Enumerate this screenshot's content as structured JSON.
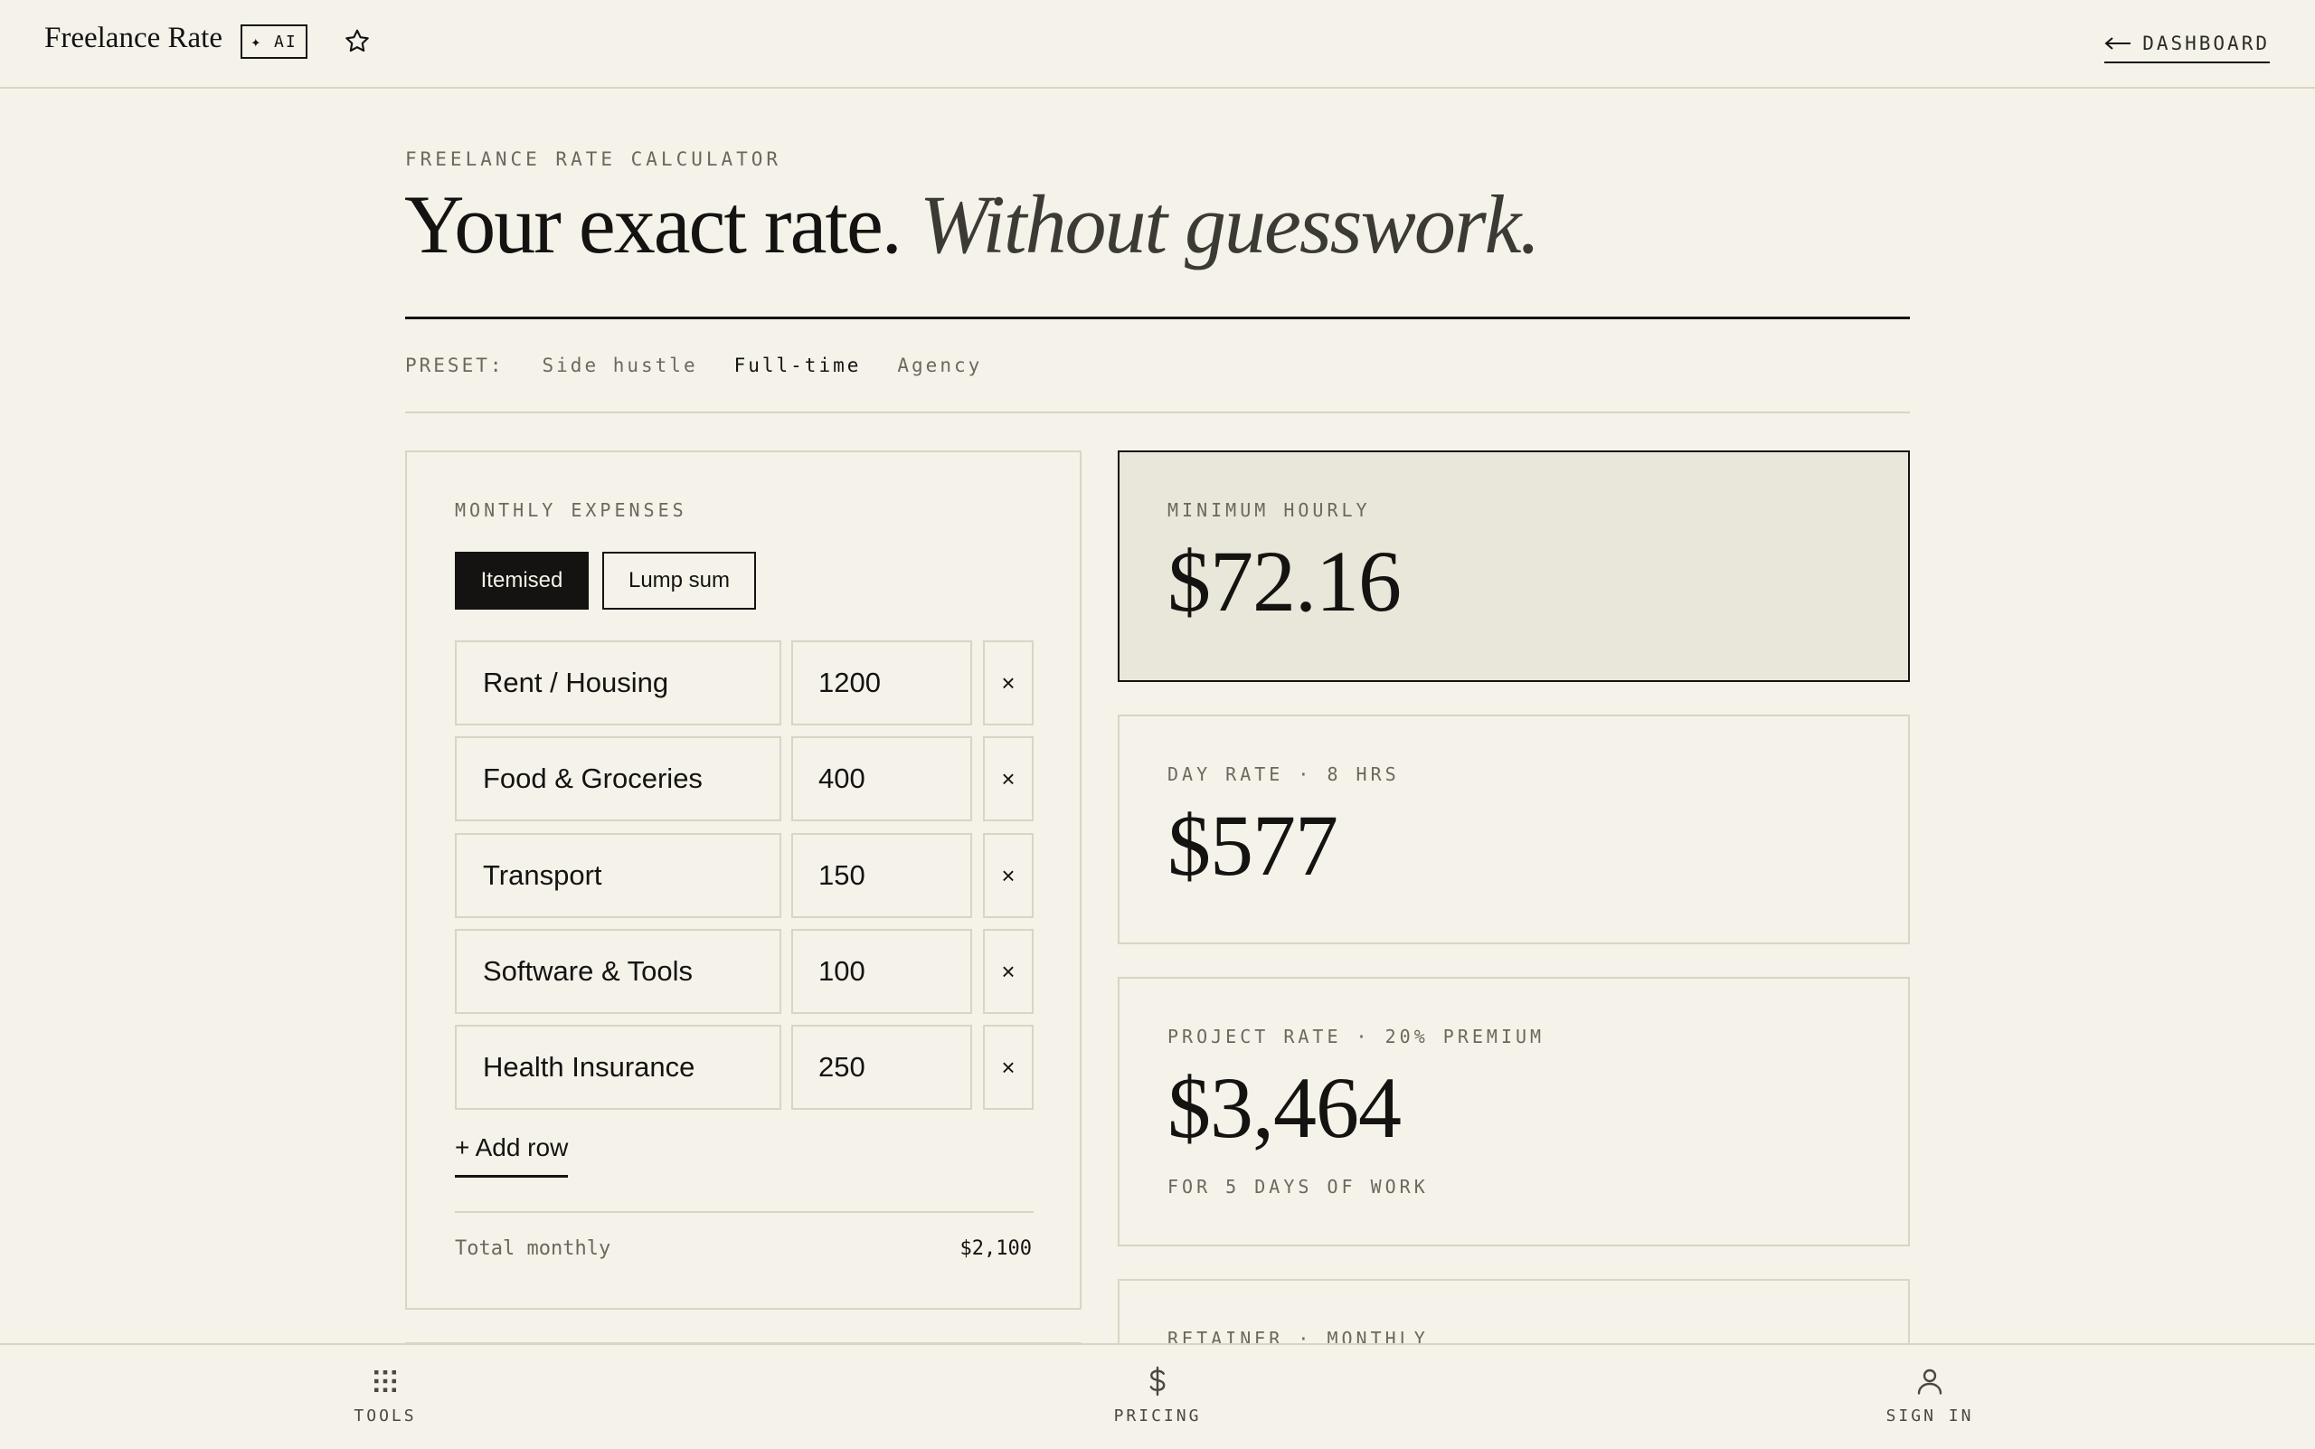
{
  "app": {
    "brand": "Freelance Rate",
    "ai_badge": "✦ AI",
    "back_link": "DASHBOARD"
  },
  "header": {
    "eyebrow": "FREELANCE RATE CALCULATOR",
    "headline_main": "Your exact rate.",
    "headline_italic": "Without guesswork."
  },
  "preset": {
    "label": "PRESET:",
    "options": [
      "Side hustle",
      "Full-time",
      "Agency"
    ],
    "selected": "Full-time"
  },
  "expenses": {
    "title": "MONTHLY EXPENSES",
    "mode_itemised": "Itemised",
    "mode_lump": "Lump sum",
    "mode_selected": "Itemised",
    "rows": [
      {
        "name": "Rent / Housing",
        "amount": "1200"
      },
      {
        "name": "Food & Groceries",
        "amount": "400"
      },
      {
        "name": "Transport",
        "amount": "150"
      },
      {
        "name": "Software & Tools",
        "amount": "100"
      },
      {
        "name": "Health Insurance",
        "amount": "250"
      }
    ],
    "remove_glyph": "×",
    "add_row": "+ Add row",
    "total_label": "Total monthly",
    "total_value": "$2,100"
  },
  "results": {
    "minimum_hourly": {
      "label": "MINIMUM HOURLY",
      "value": "$72.16"
    },
    "day_rate": {
      "label": "DAY RATE · 8 HRS",
      "value": "$577"
    },
    "project_rate": {
      "label": "PROJECT RATE · 20% PREMIUM",
      "value": "$3,464",
      "note": "FOR 5 DAYS OF WORK"
    },
    "retainer": {
      "label": "RETAINER · MONTHLY"
    }
  },
  "bottom_nav": [
    {
      "label": "TOOLS",
      "icon": "grid-icon"
    },
    {
      "label": "PRICING",
      "icon": "dollar-icon"
    },
    {
      "label": "SIGN IN",
      "icon": "user-icon"
    }
  ],
  "colors": {
    "background": "#f4f2e9",
    "ink": "#141311",
    "muted": "#6b685e",
    "border": "#d9d5c3",
    "highlight_card": "#e9e6da"
  }
}
